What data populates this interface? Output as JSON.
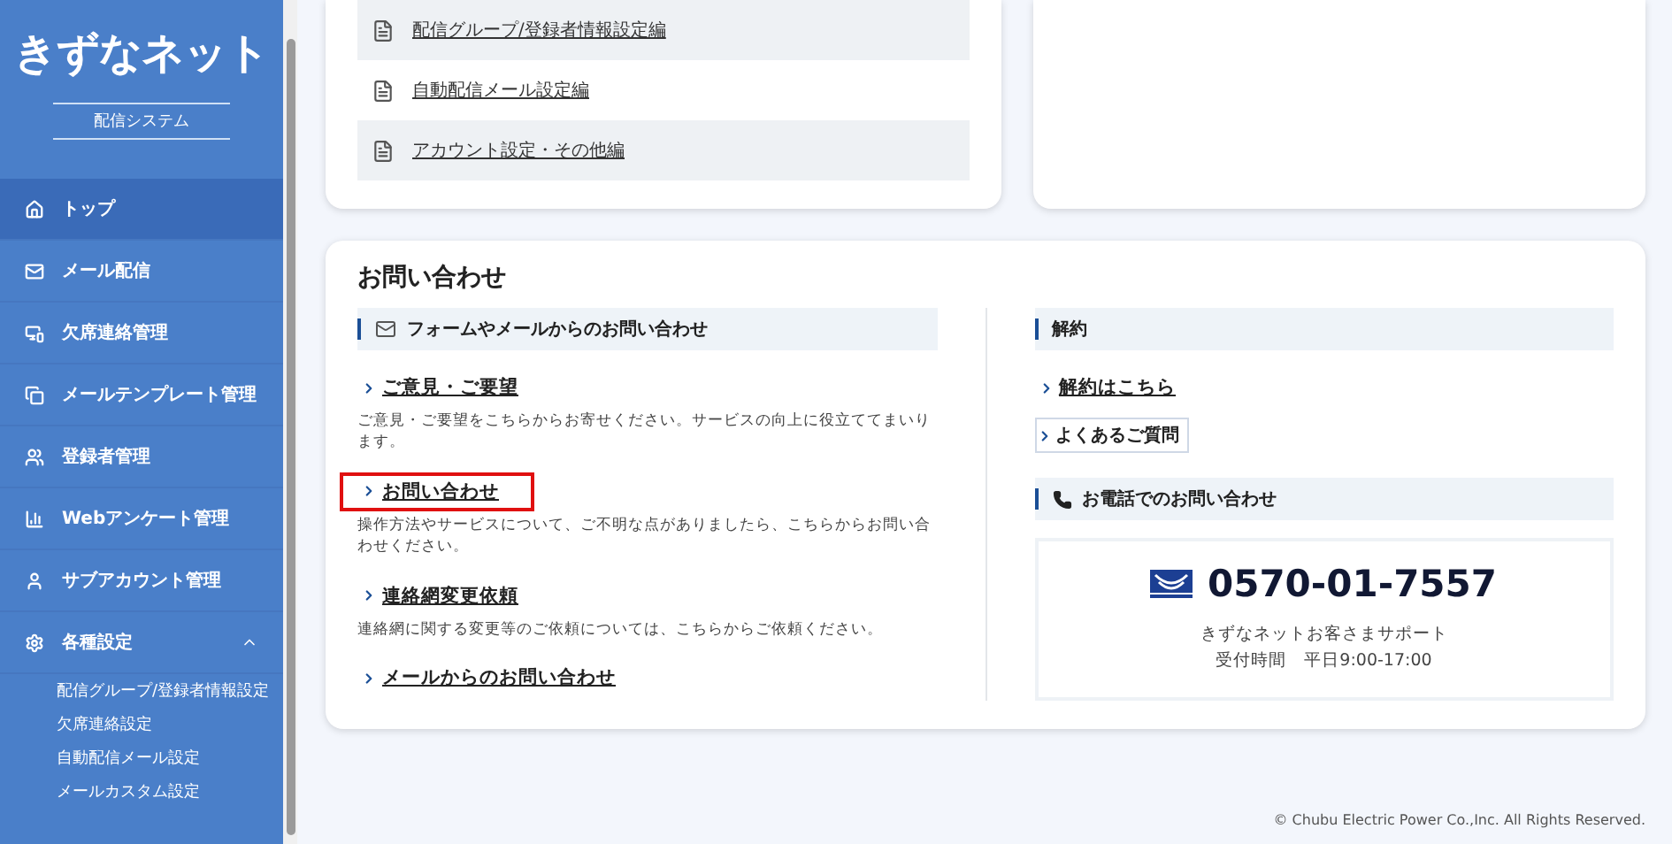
{
  "sidebar": {
    "logo": "きずなネット",
    "subtitle": "配信システム",
    "items": [
      {
        "label": "トップ",
        "selected": true
      },
      {
        "label": "メール配信",
        "selected": false
      },
      {
        "label": "欠席連絡管理",
        "selected": false
      },
      {
        "label": "メールテンプレート管理",
        "selected": false
      },
      {
        "label": "登録者管理",
        "selected": false
      },
      {
        "label": "Webアンケート管理",
        "selected": false
      },
      {
        "label": "サブアカウント管理",
        "selected": false
      },
      {
        "label": "各種設定",
        "selected": false,
        "expanded": true,
        "children": [
          {
            "label": "配信グループ/登録者情報設定"
          },
          {
            "label": "欠席連絡設定"
          },
          {
            "label": "自動配信メール設定"
          },
          {
            "label": "メールカスタム設定"
          }
        ]
      }
    ]
  },
  "manuals": [
    {
      "label": "配信グループ/登録者情報設定編",
      "shaded": true
    },
    {
      "label": "自動配信メール設定編",
      "shaded": false
    },
    {
      "label": "アカウント設定・その他編",
      "shaded": true
    }
  ],
  "contact": {
    "title": "お問い合わせ",
    "form_section": {
      "heading": "フォームやメールからのお問い合わせ",
      "links": [
        {
          "label": "ご意見・ご要望",
          "highlighted": false,
          "description": "ご意見・ご要望をこちらからお寄せください。サービスの向上に役立ててまいります。"
        },
        {
          "label": "お問い合わせ",
          "highlighted": true,
          "description": "操作方法やサービスについて、ご不明な点がありましたら、こちらからお問い合わせください。"
        },
        {
          "label": "連絡網変更依頼",
          "highlighted": false,
          "description": "連絡網に関する変更等のご依頼については、こちらからご依頼ください。"
        },
        {
          "label": "メールからのお問い合わせ",
          "highlighted": false
        }
      ]
    },
    "cancel_section": {
      "heading": "解約",
      "links": [
        {
          "label": "解約はこちら",
          "kind": "link"
        },
        {
          "label": "よくあるご質問",
          "kind": "button"
        }
      ]
    },
    "phone_section": {
      "heading": "お電話でのお問い合わせ",
      "number": "0570-01-7557",
      "support": "きずなネットお客さまサポート",
      "hours": "受付時間　平日9:00-17:00"
    }
  },
  "footer": "© Chubu Electric Power Co.,Inc. All Rights Reserved."
}
